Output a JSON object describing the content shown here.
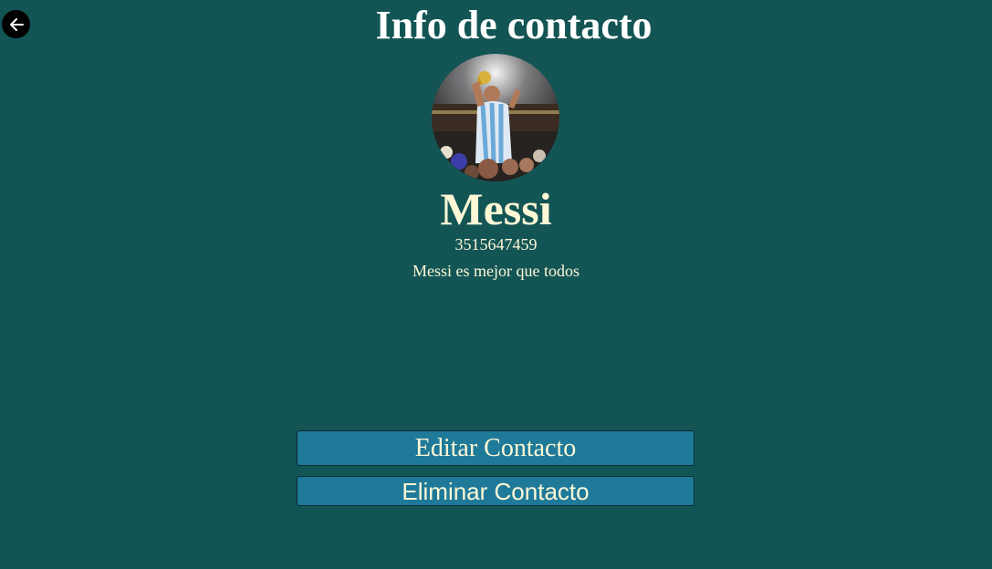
{
  "header": {
    "title": "Info de contacto",
    "back_icon": "arrow-left-icon"
  },
  "contact": {
    "name": "Messi",
    "phone": "3515647459",
    "description": "Messi es mejor que todos",
    "avatar": "contact-photo-avatar"
  },
  "actions": {
    "edit_label": "Editar Contacto",
    "delete_label": "Eliminar Contacto"
  },
  "colors": {
    "background": "#135555",
    "text": "#fdf7d6",
    "button": "#1f7a99",
    "back_button": "#000000"
  }
}
